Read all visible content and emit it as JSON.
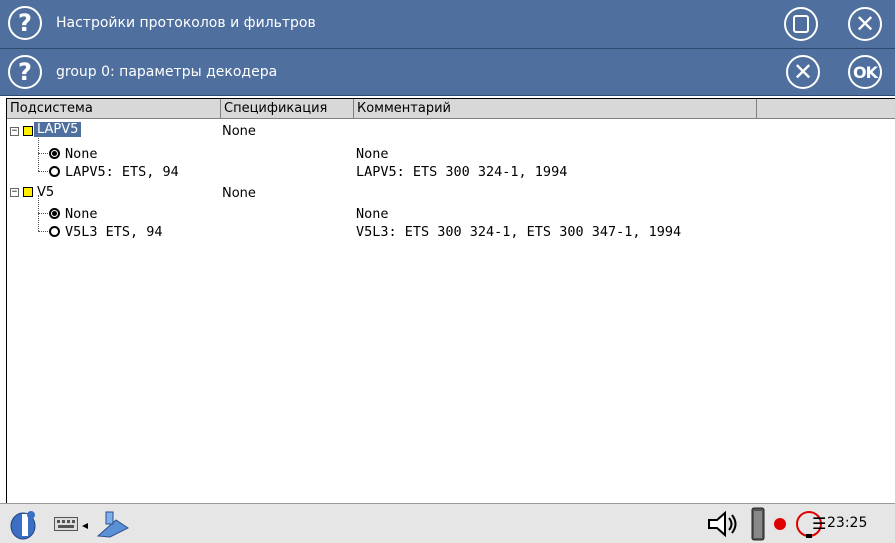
{
  "window": {
    "title": "Настройки протоколов и фильтров",
    "subtitle": "group 0: параметры декодера",
    "ok_label": "OK"
  },
  "grid": {
    "columns": [
      "Подсистема",
      "Спецификация",
      "Комментарий"
    ],
    "groups": [
      {
        "name": "LAPV5",
        "spec": "None",
        "options": [
          {
            "label": "None",
            "comment": "None",
            "selected": true
          },
          {
            "label": "LAPV5: ETS, 94",
            "comment": "LAPV5: ETS 300 324-1, 1994",
            "selected": false
          }
        ]
      },
      {
        "name": "V5",
        "spec": "None",
        "options": [
          {
            "label": "None",
            "comment": "None",
            "selected": true
          },
          {
            "label": "V5L3 ETS, 94",
            "comment": "V5L3: ETS 300 324-1, ETS 300 347-1, 1994",
            "selected": false
          }
        ]
      }
    ]
  },
  "taskbar": {
    "clock": "23:25",
    "icons": [
      "start-icon",
      "keyboard-icon",
      "network-icon",
      "speaker-icon",
      "battery-icon",
      "record-icon",
      "ring-icon",
      "menu-icon"
    ]
  },
  "colors": {
    "title_bar": "#4f6f9f",
    "selection": "#4f6f9f",
    "folder": "#ffee00",
    "record": "#e00000"
  }
}
